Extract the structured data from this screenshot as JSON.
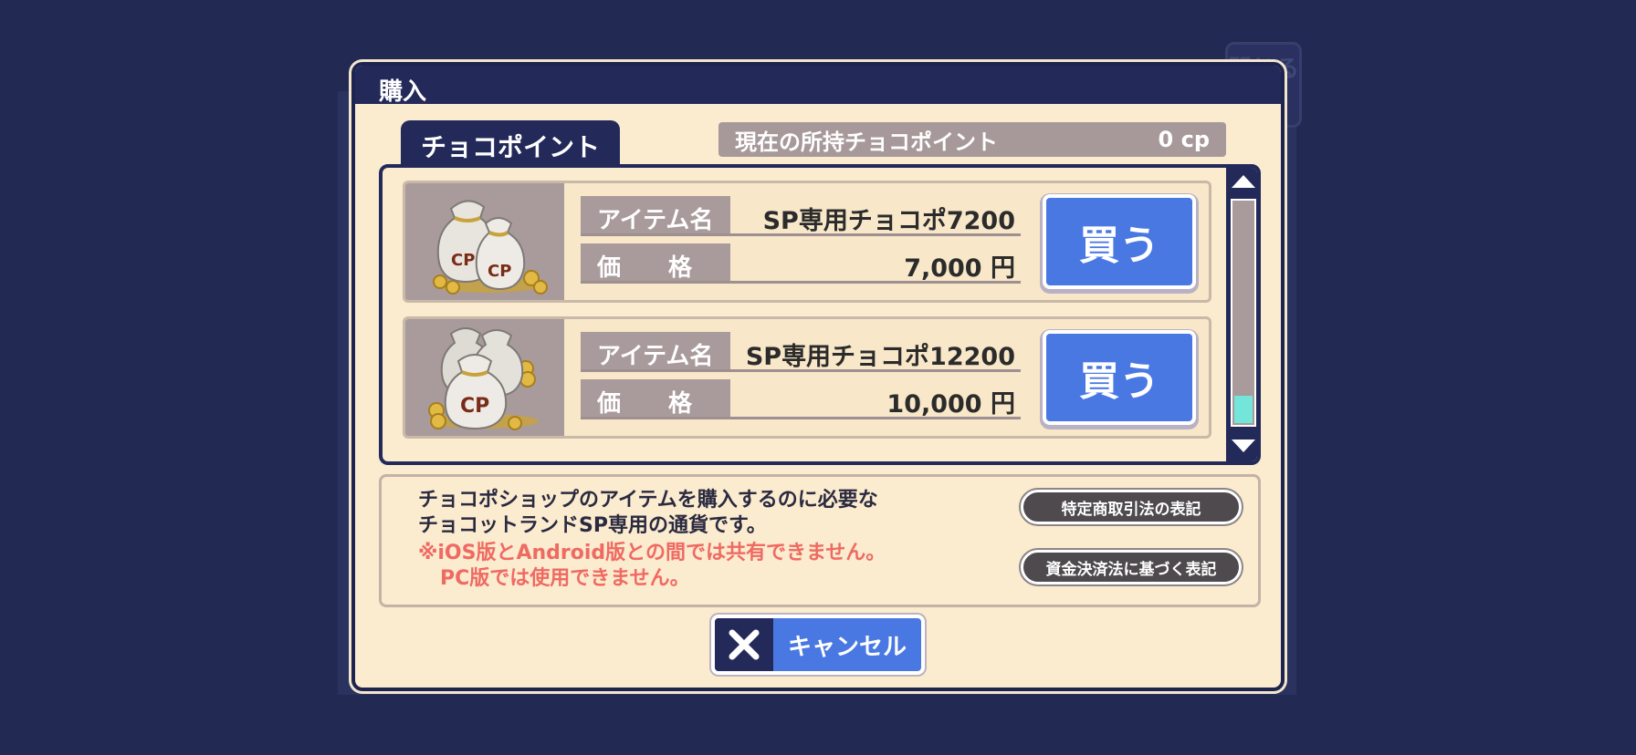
{
  "background": {
    "close_ghost_label": "閉じる"
  },
  "modal": {
    "title": "購入",
    "tab_label": "チョコポイント",
    "points": {
      "label": "現在の所持チョコポイント",
      "value": "0 cp"
    }
  },
  "items": [
    {
      "name_label": "アイテム名",
      "name": "SP専用チョコポ7200",
      "price_label": "価　　格",
      "price": "7,000 円",
      "buy_label": "買う",
      "icon": "coin-bags-icon",
      "bag_text": "CP"
    },
    {
      "name_label": "アイテム名",
      "name": "SP専用チョコポ12200",
      "price_label": "価　　格",
      "price": "10,000 円",
      "buy_label": "買う",
      "icon": "coin-bags-icon",
      "bag_text": "CP"
    }
  ],
  "info": {
    "line1": "チョコポショップのアイテムを購入するのに必要な",
    "line2": "チョコットランドSP専用の通貨です。",
    "warning1": "※iOS版とAndroid版との間では共有できません。",
    "warning2": "PC版では使用できません。",
    "legal_button_1": "特定商取引法の表記",
    "legal_button_2": "資金決済法に基づく表記"
  },
  "cancel": {
    "label": "キャンセル",
    "icon": "close-x-icon"
  },
  "colors": {
    "navy": "#232a5a",
    "cream": "#fbebcf",
    "button_blue": "#4a78e3",
    "warning_red": "#ef6a62",
    "scroll_thumb": "#74e6d9"
  }
}
